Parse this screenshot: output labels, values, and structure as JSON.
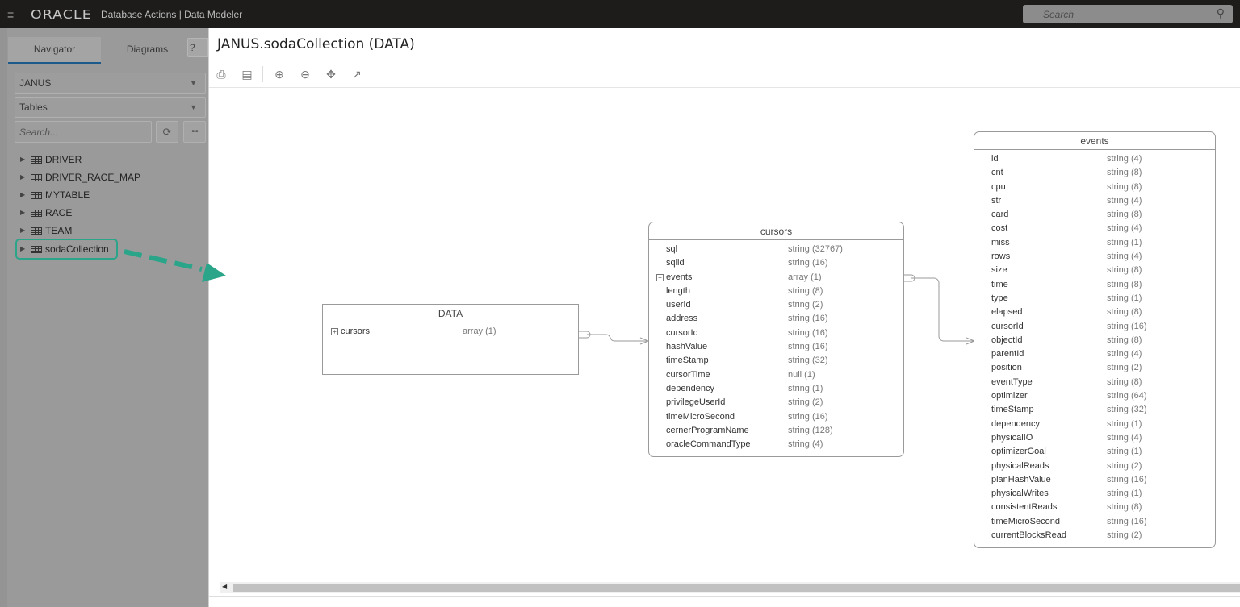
{
  "topbar": {
    "menu_icon": "hamburger-icon",
    "brand": "ORACLE",
    "app_title": "Database Actions |  Data Modeler",
    "search_placeholder": "Search",
    "search_icon": "search-icon"
  },
  "navigator": {
    "tabs": [
      {
        "label": "Navigator",
        "active": true
      },
      {
        "label": "Diagrams",
        "active": false
      }
    ],
    "help_label": "?",
    "schema_select": "JANUS",
    "object_type_select": "Tables",
    "search_placeholder": "Search...",
    "refresh_icon": "refresh-icon",
    "more_label": "•••",
    "tree": [
      {
        "label": "DRIVER",
        "highlighted": false
      },
      {
        "label": "DRIVER_RACE_MAP",
        "highlighted": false
      },
      {
        "label": "MYTABLE",
        "highlighted": false
      },
      {
        "label": "RACE",
        "highlighted": false
      },
      {
        "label": "TEAM",
        "highlighted": false
      },
      {
        "label": "sodaCollection",
        "highlighted": true
      }
    ],
    "annotation_color": "#2aa589"
  },
  "main": {
    "title": "JANUS.sodaCollection (DATA)",
    "toolbar": [
      "print-icon",
      "export-image-icon",
      "zoom-in-icon",
      "zoom-out-icon",
      "fit-icon",
      "expand-icon"
    ]
  },
  "diagram": {
    "entities": {
      "data": {
        "name": "DATA",
        "fields": [
          {
            "name": "cursors",
            "type": "array (1)",
            "expandable": true
          }
        ]
      },
      "cursors": {
        "name": "cursors",
        "fields": [
          {
            "name": "sql",
            "type": "string (32767)"
          },
          {
            "name": "sqlid",
            "type": "string (16)"
          },
          {
            "name": "events",
            "type": "array (1)",
            "expandable": true
          },
          {
            "name": "length",
            "type": "string (8)"
          },
          {
            "name": "userId",
            "type": "string (2)"
          },
          {
            "name": "address",
            "type": "string (16)"
          },
          {
            "name": "cursorId",
            "type": "string (16)"
          },
          {
            "name": "hashValue",
            "type": "string (16)"
          },
          {
            "name": "timeStamp",
            "type": "string (32)"
          },
          {
            "name": "cursorTime",
            "type": "null (1)"
          },
          {
            "name": "dependency",
            "type": "string (1)"
          },
          {
            "name": "privilegeUserId",
            "type": "string (2)"
          },
          {
            "name": "timeMicroSecond",
            "type": "string (16)"
          },
          {
            "name": "cernerProgramName",
            "type": "string (128)"
          },
          {
            "name": "oracleCommandType",
            "type": "string (4)"
          }
        ]
      },
      "events": {
        "name": "events",
        "fields": [
          {
            "name": "id",
            "type": "string (4)"
          },
          {
            "name": "cnt",
            "type": "string (8)"
          },
          {
            "name": "cpu",
            "type": "string (8)"
          },
          {
            "name": "str",
            "type": "string (4)"
          },
          {
            "name": "card",
            "type": "string (8)"
          },
          {
            "name": "cost",
            "type": "string (4)"
          },
          {
            "name": "miss",
            "type": "string (1)"
          },
          {
            "name": "rows",
            "type": "string (4)"
          },
          {
            "name": "size",
            "type": "string (8)"
          },
          {
            "name": "time",
            "type": "string (8)"
          },
          {
            "name": "type",
            "type": "string (1)"
          },
          {
            "name": "elapsed",
            "type": "string (8)"
          },
          {
            "name": "cursorId",
            "type": "string (16)"
          },
          {
            "name": "objectId",
            "type": "string (8)"
          },
          {
            "name": "parentId",
            "type": "string (4)"
          },
          {
            "name": "position",
            "type": "string (2)"
          },
          {
            "name": "eventType",
            "type": "string (8)"
          },
          {
            "name": "optimizer",
            "type": "string (64)"
          },
          {
            "name": "timeStamp",
            "type": "string (32)"
          },
          {
            "name": "dependency",
            "type": "string (1)"
          },
          {
            "name": "physicalIO",
            "type": "string (4)"
          },
          {
            "name": "optimizerGoal",
            "type": "string (1)"
          },
          {
            "name": "physicalReads",
            "type": "string (2)"
          },
          {
            "name": "planHashValue",
            "type": "string (16)"
          },
          {
            "name": "physicalWrites",
            "type": "string (1)"
          },
          {
            "name": "consistentReads",
            "type": "string (8)"
          },
          {
            "name": "timeMicroSecond",
            "type": "string (16)"
          },
          {
            "name": "currentBlocksRead",
            "type": "string (2)"
          }
        ]
      }
    },
    "relations": [
      {
        "from": "DATA.cursors",
        "to": "cursors",
        "cardinality": "one-to-many"
      },
      {
        "from": "cursors.events",
        "to": "events",
        "cardinality": "one-to-many"
      }
    ]
  }
}
